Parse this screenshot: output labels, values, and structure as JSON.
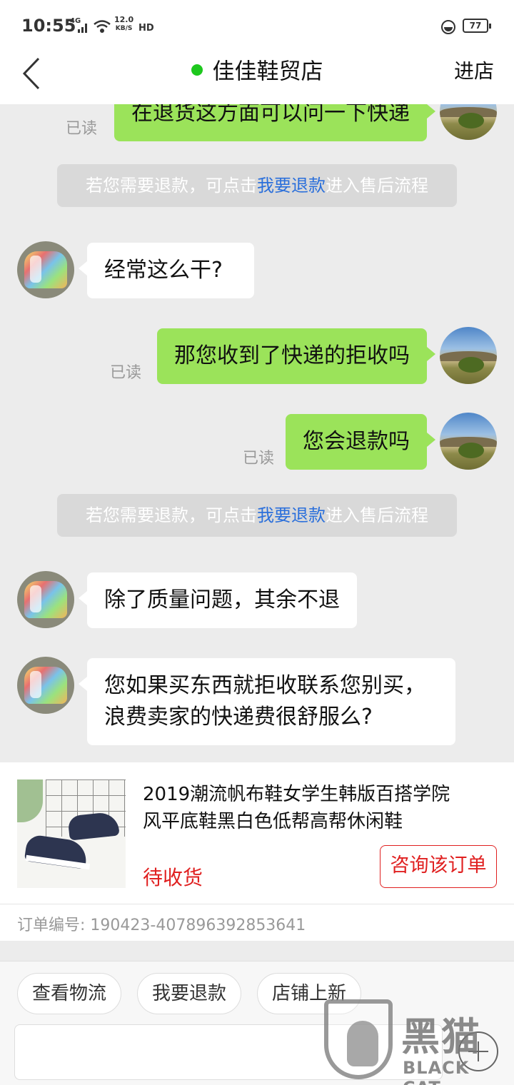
{
  "status_bar": {
    "time": "10:55",
    "network": "4G",
    "speed": "12.0",
    "speed_unit": "KB/S",
    "hd": "HD",
    "battery": "77"
  },
  "header": {
    "title": "佳佳鞋贸店",
    "enter_store": "进店",
    "online_color": "#1ec81e"
  },
  "messages": [
    {
      "side": "right",
      "text": "在退货这方面可以问一下快递",
      "read_label": "已读"
    },
    {
      "type": "notice",
      "prefix": "若您需要退款，可点击",
      "link": "我要退款",
      "suffix": "进入售后流程"
    },
    {
      "side": "left",
      "text": "经常这么干?"
    },
    {
      "side": "right",
      "text": "那您收到了快递的拒收吗",
      "read_label": "已读"
    },
    {
      "side": "right",
      "text": "您会退款吗",
      "read_label": "已读"
    },
    {
      "type": "notice",
      "prefix": "若您需要退款，可点击",
      "link": "我要退款",
      "suffix": "进入售后流程"
    },
    {
      "side": "left",
      "text": "除了质量问题，其余不退"
    },
    {
      "side": "left",
      "lines": [
        "您如果买东西就拒收联系您别买，",
        "浪费卖家的快递费很舒服么?"
      ]
    }
  ],
  "order": {
    "title_lines": [
      "2019潮流帆布鞋女学生韩版百搭学院",
      "风平底鞋黑白色低帮高帮休闲鞋"
    ],
    "status": "待收货",
    "consult_button": "咨询该订单",
    "order_no_label": "订单编号:",
    "order_no": "190423-407896392853641"
  },
  "quick_actions": [
    "查看物流",
    "我要退款",
    "店铺上新"
  ],
  "watermark": {
    "zh": "黑猫",
    "en": "BLACK CAT"
  },
  "colors": {
    "bubble_right": "#9be35a",
    "link": "#2a6fdb",
    "accent_red": "#e02020"
  }
}
